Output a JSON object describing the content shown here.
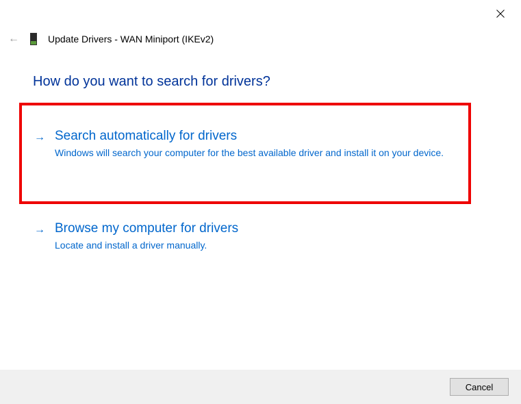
{
  "header": {
    "title": "Update Drivers - WAN Miniport (IKEv2)"
  },
  "main": {
    "heading": "How do you want to search for drivers?",
    "options": [
      {
        "title": "Search automatically for drivers",
        "description": "Windows will search your computer for the best available driver and install it on your device."
      },
      {
        "title": "Browse my computer for drivers",
        "description": "Locate and install a driver manually."
      }
    ]
  },
  "footer": {
    "cancel_label": "Cancel"
  }
}
